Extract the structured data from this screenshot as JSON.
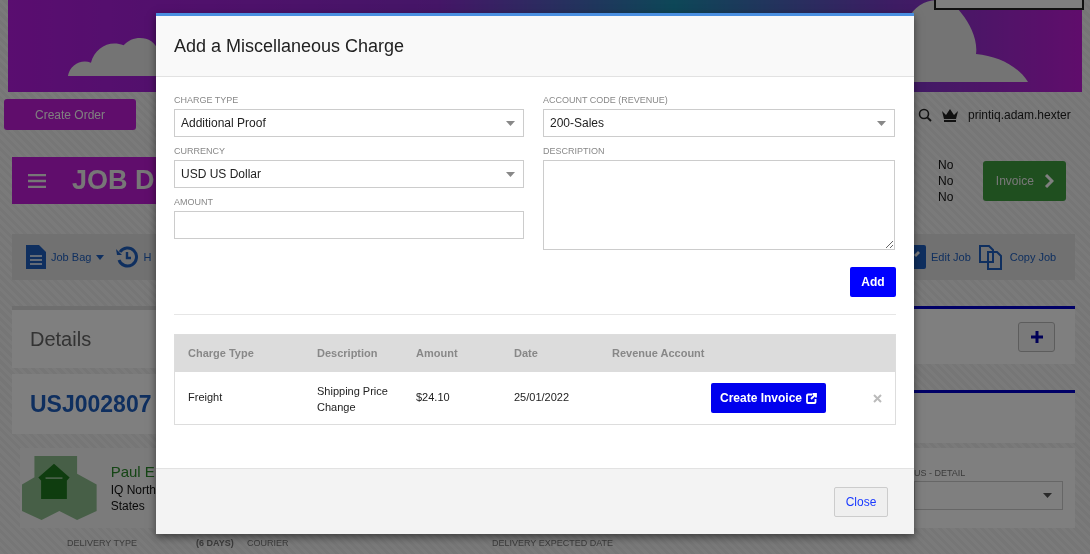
{
  "background": {
    "create_order_button": "Create Order",
    "user": "printiq.adam.hexter",
    "page_title": "JOB D",
    "flags": [
      "No",
      "No",
      "No"
    ],
    "invoice_button": "Invoice",
    "toolbar_left": [
      {
        "label": "Job Bag",
        "kind": "dropdown"
      },
      {
        "label": "H",
        "kind": "history"
      }
    ],
    "toolbar_right": [
      {
        "label": "Edit Job",
        "kind": "edit"
      },
      {
        "label": "Copy Job",
        "kind": "copy"
      }
    ],
    "details_title": "Details",
    "job_number": "USJ002807",
    "customer": {
      "name": "Paul E",
      "lines": [
        "IQ North",
        "States"
      ]
    },
    "status_label": "US - DETAIL",
    "bottom_labels": [
      {
        "text": "DELIVERY TYPE",
        "kind": "label"
      },
      {
        "text": "(6 DAYS)",
        "kind": "strong"
      },
      {
        "text": "COURIER",
        "kind": "label"
      },
      {
        "text": "DELIVERY EXPECTED DATE",
        "kind": "label"
      }
    ]
  },
  "modal": {
    "title": "Add a Miscellaneous Charge",
    "left_fields": [
      {
        "label": "CHARGE TYPE",
        "kind": "select",
        "value": "Additional Proof"
      },
      {
        "label": "CURRENCY",
        "kind": "select",
        "value": "USD US Dollar"
      },
      {
        "label": "AMOUNT",
        "kind": "input"
      }
    ],
    "right_fields": [
      {
        "label": "ACCOUNT CODE (REVENUE)",
        "kind": "select",
        "value": "200-Sales"
      },
      {
        "label": "DESCRIPTION",
        "kind": "textarea"
      }
    ],
    "add_button": "Add",
    "table": {
      "columns": [
        "Charge Type",
        "Description",
        "Amount",
        "Date",
        "Revenue Account"
      ],
      "rows": [
        {
          "charge_type": "Freight",
          "description": "Shipping Price Change",
          "amount": "$24.10",
          "date": "25/01/2022",
          "action": "Create Invoice"
        }
      ]
    },
    "close_button": "Close"
  }
}
